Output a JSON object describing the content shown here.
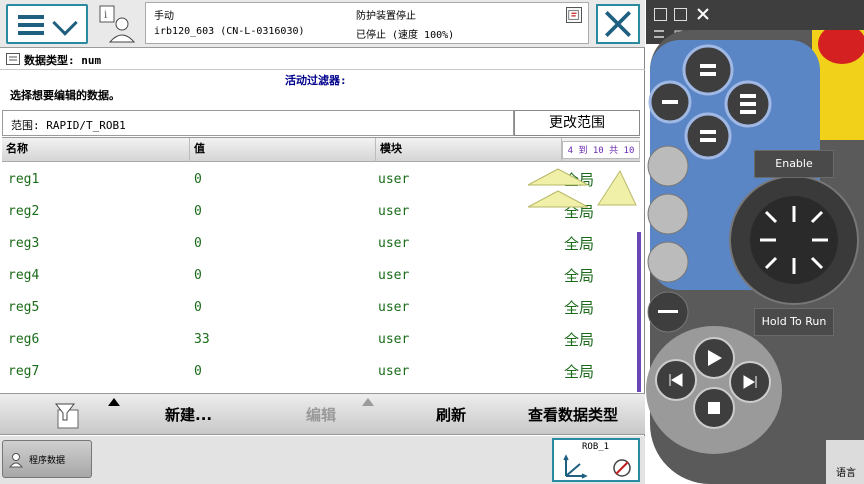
{
  "header": {
    "mode": "手动",
    "controller": "irb120_603 (CN-L-0316030)",
    "safety": "防护装置停止",
    "state": "已停止 (速度 100%)"
  },
  "view": {
    "title": "数据类型: num",
    "filter_label": "活动过滤器:",
    "instruction": "选择想要编辑的数据。",
    "scope": "范围: RAPID/T_ROB1",
    "change_scope": "更改范围"
  },
  "table": {
    "columns": [
      "名称",
      "值",
      "模块"
    ],
    "page_info": "4 到 10 共 10",
    "rows": [
      {
        "name": "reg1",
        "value": "0",
        "module": "user",
        "scope": "全局"
      },
      {
        "name": "reg2",
        "value": "0",
        "module": "user",
        "scope": "全局"
      },
      {
        "name": "reg3",
        "value": "0",
        "module": "user",
        "scope": "全局"
      },
      {
        "name": "reg4",
        "value": "0",
        "module": "user",
        "scope": "全局"
      },
      {
        "name": "reg5",
        "value": "0",
        "module": "user",
        "scope": "全局"
      },
      {
        "name": "reg6",
        "value": "33",
        "module": "user",
        "scope": "全局"
      },
      {
        "name": "reg7",
        "value": "0",
        "module": "user",
        "scope": "全局"
      }
    ]
  },
  "commands": {
    "new": "新建...",
    "edit": "编辑",
    "refresh": "刷新",
    "view_type": "查看数据类型"
  },
  "taskbar": {
    "program_data": "程序数据",
    "robot": "ROB_1"
  },
  "controller_device": {
    "enable": "Enable",
    "hold": "Hold To Run",
    "lang": "语言"
  },
  "colors": {
    "accent": "#2a8aa0",
    "row_text": "#1a6b1a",
    "filter_text": "#00008b",
    "device_blue": "#5b86c6",
    "emergency": "#d42020"
  }
}
